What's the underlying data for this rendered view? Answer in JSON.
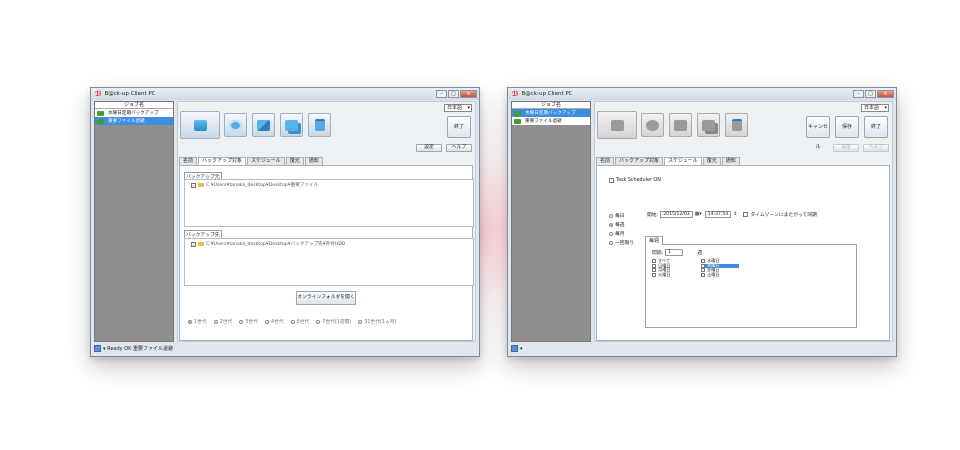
{
  "app": {
    "title": "B@ck-up Client PC",
    "icon": "app-logo-icon"
  },
  "common": {
    "language": "日本語",
    "job_header": "ジョブ名",
    "jobs": [
      "水曜日定期バックアップ",
      "重要ファイル退避"
    ],
    "finish_label": "終了",
    "settings_label": "設定",
    "help_label": "ヘルプ",
    "tabs": [
      "名前",
      "バックアップ対象",
      "スケジュール",
      "復元",
      "通知"
    ]
  },
  "left": {
    "selected_job": 1,
    "active_tab": 1,
    "toolbar_icons": [
      "monitor-icon",
      "sync-icon",
      "edit-icon",
      "copy-icon",
      "trash-icon"
    ],
    "source_label": "バックアップ元",
    "source_path": "C:¥Users¥tanaka_desktop¥Desktop¥重要ファイル",
    "dest_label": "バックアップ先",
    "dest_path": "C:¥Users¥tanaka_desktop¥Desktop¥バックアップ先¥外付HDD",
    "online_button": "オンラインフォルダを開く",
    "generations": [
      "1世代",
      "2世代",
      "3世代",
      "4世代",
      "5世代",
      "7世代(1週間)",
      "31世代(1ヵ月)"
    ],
    "generation_selected": 0,
    "status": "Ready OK 重要ファイル退避"
  },
  "right": {
    "selected_job": 0,
    "active_tab": 2,
    "toolbar_disabled_icons": [
      "monitor-icon",
      "sync-icon",
      "edit-icon",
      "copy-icon",
      "trash-icon"
    ],
    "cancel_label": "キャンセル",
    "save_label": "保存",
    "task_scheduler": "Task Scheduler ON",
    "freq": [
      "毎日",
      "毎週",
      "毎月",
      "一回限り"
    ],
    "freq_selected": 1,
    "start_label": "開始:",
    "start_date": "2015/12/03",
    "start_time": "14:37:54",
    "timezone_label": "タイムゾーンにまたがって同期",
    "week_tab": "毎週",
    "interval_label": "間隔:",
    "interval_value": "1",
    "interval_unit": "週",
    "days_col1": [
      "すべて",
      "日曜日",
      "月曜日",
      "火曜日"
    ],
    "days_col2": [
      "水曜日",
      "木曜日",
      "金曜日",
      "土曜日"
    ],
    "checked_day": "木曜日"
  }
}
